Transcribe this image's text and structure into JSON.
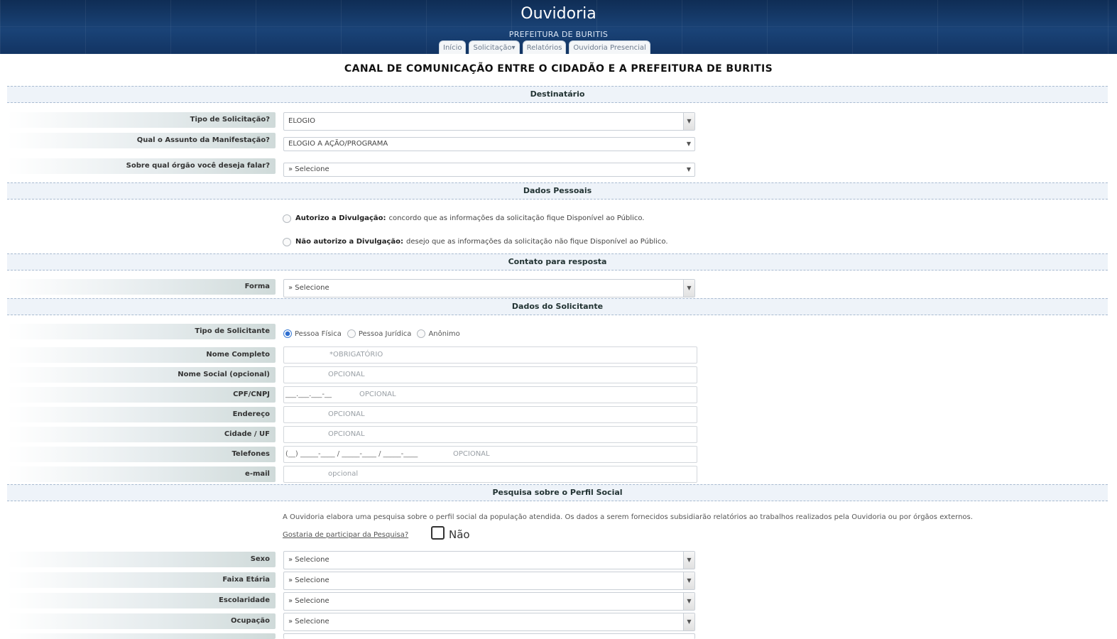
{
  "header": {
    "title": "Ouvidoria",
    "subtitle": "PREFEITURA DE BURITIS",
    "nav": [
      "Início",
      "Solicitação▾",
      "Relatórios",
      "Ouvidoria Presencial"
    ]
  },
  "page_title": "CANAL DE COMUNICAÇÃO ENTRE O CIDADÃO E A PREFEITURA DE BURITIS",
  "sections": {
    "destinatario": "Destinatário",
    "dados_pessoais": "Dados Pessoais",
    "contato": "Contato para resposta",
    "solicitante": "Dados do Solicitante",
    "pesquisa": "Pesquisa sobre o Perfil Social"
  },
  "destinatario": {
    "tipo_label": "Tipo de Solicitação?",
    "tipo_value": "ELOGIO",
    "assunto_label": "Qual o Assunto da Manifestação?",
    "assunto_value": "ELOGIO A AÇÃO/PROGRAMA",
    "orgao_label": "Sobre qual órgão você deseja falar?",
    "orgao_value": "» Selecione"
  },
  "dados_pessoais": {
    "autorizo_bold": "Autorizo a Divulgação:",
    "autorizo_text": "concordo que as informações da solicitação fique Disponível ao Público.",
    "nao_autorizo_bold": "Não autorizo a Divulgação:",
    "nao_autorizo_text": "desejo que as informações da solicitação não fique Disponível ao Público."
  },
  "contato": {
    "forma_label": "Forma",
    "forma_value": "» Selecione"
  },
  "solicitante": {
    "tipo_label": "Tipo de Solicitante",
    "tipos": [
      "Pessoa Física",
      "Pessoa Jurídica",
      "Anônimo"
    ],
    "fields": [
      {
        "label": "Nome Completo",
        "mask": "",
        "placeholder": "*OBRIGATÓRIO"
      },
      {
        "label": "Nome Social (opcional)",
        "mask": "",
        "placeholder": "OPCIONAL"
      },
      {
        "label": "CPF/CNPJ",
        "mask": "___.___.___-__",
        "placeholder": "OPCIONAL"
      },
      {
        "label": "Endereço",
        "mask": "",
        "placeholder": "OPCIONAL"
      },
      {
        "label": "Cidade / UF",
        "mask": "",
        "placeholder": "OPCIONAL"
      },
      {
        "label": "Telefones",
        "mask": "(__) _____-____ / _____-____ / _____-____",
        "placeholder": "OPCIONAL"
      },
      {
        "label": "e-mail",
        "mask": "",
        "placeholder": "opcional"
      }
    ]
  },
  "pesquisa": {
    "text": "A Ouvidoria elabora uma pesquisa sobre o perfil social da população atendida. Os dados a serem fornecidos subsidiarão relatórios ao trabalhos realizados pela Ouvidoria ou por órgãos externos.",
    "question": "Gostaria de participar da Pesquisa?",
    "checkbox_label": "Não",
    "fields": [
      {
        "label": "Sexo",
        "value": "» Selecione"
      },
      {
        "label": "Faixa Etária",
        "value": "» Selecione"
      },
      {
        "label": "Escolaridade",
        "value": "» Selecione"
      },
      {
        "label": "Ocupação",
        "value": "» Selecione"
      }
    ]
  }
}
